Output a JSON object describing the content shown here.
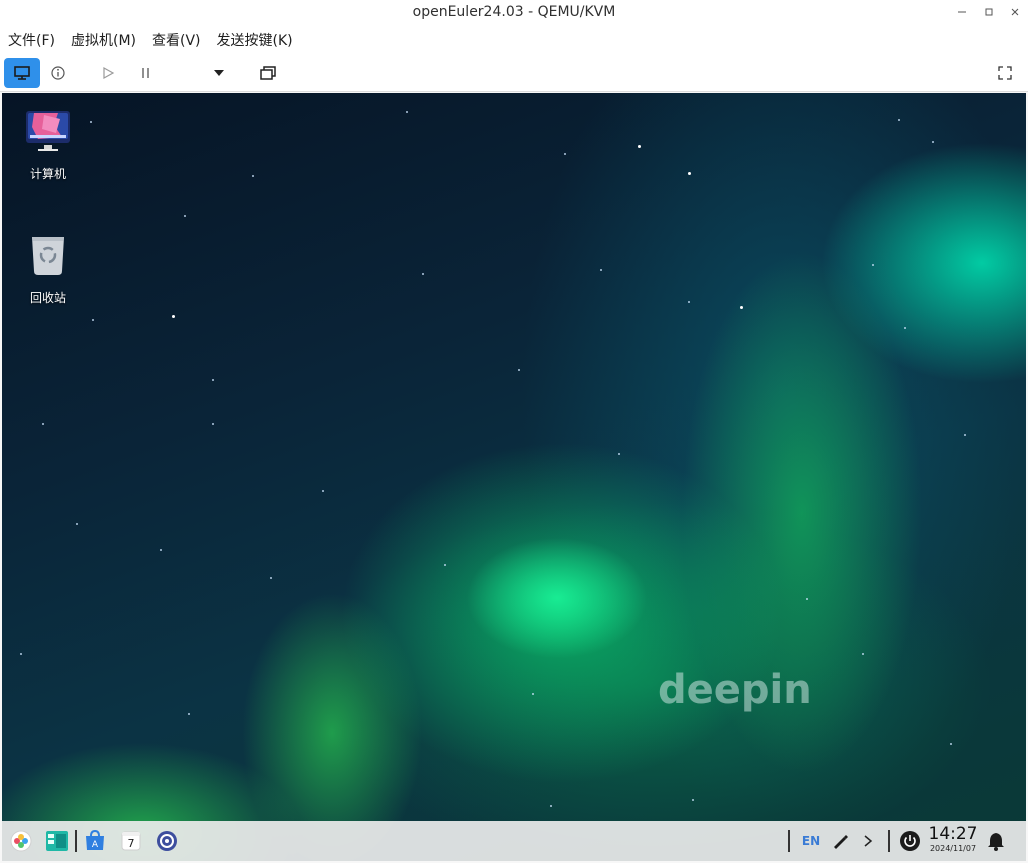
{
  "window": {
    "title": "openEuler24.03 - QEMU/KVM",
    "minimize_icon": "minimize-icon",
    "maximize_icon": "maximize-icon",
    "close_icon": "close-icon"
  },
  "menubar": {
    "items": [
      {
        "label": "文件(F)"
      },
      {
        "label": "虚拟机(M)"
      },
      {
        "label": "查看(V)"
      },
      {
        "label": "发送按键(K)"
      }
    ]
  },
  "toolbar": {
    "buttons": [
      {
        "name": "console",
        "icon": "monitor-icon",
        "active": true
      },
      {
        "name": "details",
        "icon": "info-icon"
      },
      {
        "name": "run",
        "icon": "play-icon"
      },
      {
        "name": "pause",
        "icon": "pause-icon"
      },
      {
        "name": "power-menu",
        "icon": "dropdown-arrow-icon"
      },
      {
        "name": "snapshots",
        "icon": "snapshot-icon"
      },
      {
        "name": "fullscreen",
        "icon": "fullscreen-icon"
      }
    ],
    "accent": "#2f90ea"
  },
  "desktop": {
    "icons": [
      {
        "label": "计算机",
        "icon": "computer-icon"
      },
      {
        "label": "回收站",
        "icon": "trash-icon"
      }
    ],
    "watermark": "deepin"
  },
  "dock": {
    "apps": [
      {
        "name": "launcher",
        "icon": "launcher-icon"
      },
      {
        "name": "file-manager",
        "icon": "file-manager-icon"
      },
      {
        "name": "app-store",
        "icon": "app-store-icon"
      },
      {
        "name": "calendar",
        "icon": "calendar-icon",
        "day": "7"
      },
      {
        "name": "settings",
        "icon": "settings-icon"
      }
    ],
    "tray": {
      "input_method": "EN",
      "pen_icon": "pen-icon",
      "expand_icon": "chevron-right-icon",
      "power_icon": "power-icon",
      "notification_icon": "bell-icon"
    },
    "clock": {
      "time": "14:27",
      "date": "2024/11/07"
    }
  }
}
